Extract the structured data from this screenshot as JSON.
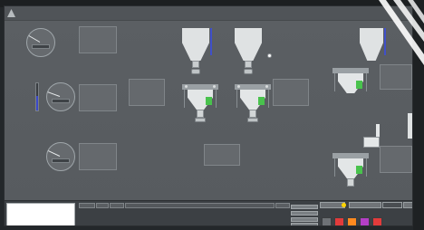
{
  "header": {
    "title": "",
    "breadcrumb": ""
  },
  "gauges": [
    {
      "name": "",
      "value": "",
      "level_pct": 0
    },
    {
      "name": "",
      "value": "",
      "level_pct": 55
    },
    {
      "name": "",
      "value": "",
      "level_pct": 0
    }
  ],
  "info_boxes": [
    {
      "title": "",
      "rows": [
        {
          "k": "",
          "v": ""
        },
        {
          "k": "",
          "v": ""
        },
        {
          "k": "",
          "v": ""
        },
        {
          "k": "",
          "v": ""
        },
        {
          "k": "",
          "v": ""
        }
      ]
    },
    {
      "title": "",
      "rows": [
        {
          "k": "",
          "v": ""
        },
        {
          "k": "",
          "v": ""
        },
        {
          "k": "",
          "v": ""
        },
        {
          "k": "",
          "v": ""
        },
        {
          "k": "",
          "v": ""
        }
      ]
    },
    {
      "title": "",
      "rows": [
        {
          "k": "",
          "v": ""
        },
        {
          "k": "",
          "v": ""
        },
        {
          "k": "",
          "v": ""
        },
        {
          "k": "",
          "v": ""
        },
        {
          "k": "",
          "v": ""
        }
      ]
    },
    {
      "title": "",
      "rows": [
        {
          "k": "",
          "v": ""
        },
        {
          "k": "",
          "v": ""
        },
        {
          "k": "",
          "v": ""
        },
        {
          "k": "",
          "v": ""
        },
        {
          "k": "",
          "v": ""
        }
      ]
    },
    {
      "title": "",
      "rows": [
        {
          "k": "",
          "v": ""
        },
        {
          "k": "",
          "v": ""
        },
        {
          "k": "",
          "v": ""
        },
        {
          "k": "",
          "v": ""
        },
        {
          "k": "",
          "v": ""
        }
      ]
    },
    {
      "title": "",
      "rows": [
        {
          "k": "",
          "v": ""
        },
        {
          "k": "",
          "v": ""
        },
        {
          "k": "",
          "v": ""
        },
        {
          "k": "",
          "v": ""
        }
      ]
    },
    {
      "title": "",
      "rows": [
        {
          "k": "",
          "v": ""
        },
        {
          "k": "",
          "v": ""
        },
        {
          "k": "",
          "v": ""
        },
        {
          "k": "",
          "v": ""
        },
        {
          "k": "",
          "v": ""
        }
      ]
    },
    {
      "title": "",
      "rows": [
        {
          "k": "",
          "v": ""
        },
        {
          "k": "",
          "v": ""
        },
        {
          "k": "",
          "v": ""
        },
        {
          "k": "",
          "v": ""
        },
        {
          "k": "",
          "v": ""
        }
      ]
    }
  ],
  "hoppers": [
    {
      "label": ""
    },
    {
      "label": ""
    },
    {
      "label": ""
    }
  ],
  "scales": [
    {
      "label": ""
    },
    {
      "label": ""
    },
    {
      "label": ""
    },
    {
      "label": ""
    }
  ],
  "bottom": {
    "tabs": [
      "",
      "",
      "",
      ""
    ],
    "top_buttons": [
      "",
      "",
      "",
      ""
    ],
    "indicators": [
      {
        "label": "",
        "color": "#6e7276"
      },
      {
        "label": "",
        "color": "#e23b3b"
      },
      {
        "label": "",
        "color": "#ff8a1f"
      },
      {
        "label": "",
        "color": "#b43fc6"
      },
      {
        "label": "",
        "color": "#e23b3b"
      }
    ]
  },
  "colors": {
    "level_fill": "#3b49c9",
    "highlight_yellow": "#ffe24a",
    "highlight_green": "#6fe36f",
    "scale_green": "#49c24d",
    "indicator_yellow": "#ffd500"
  }
}
